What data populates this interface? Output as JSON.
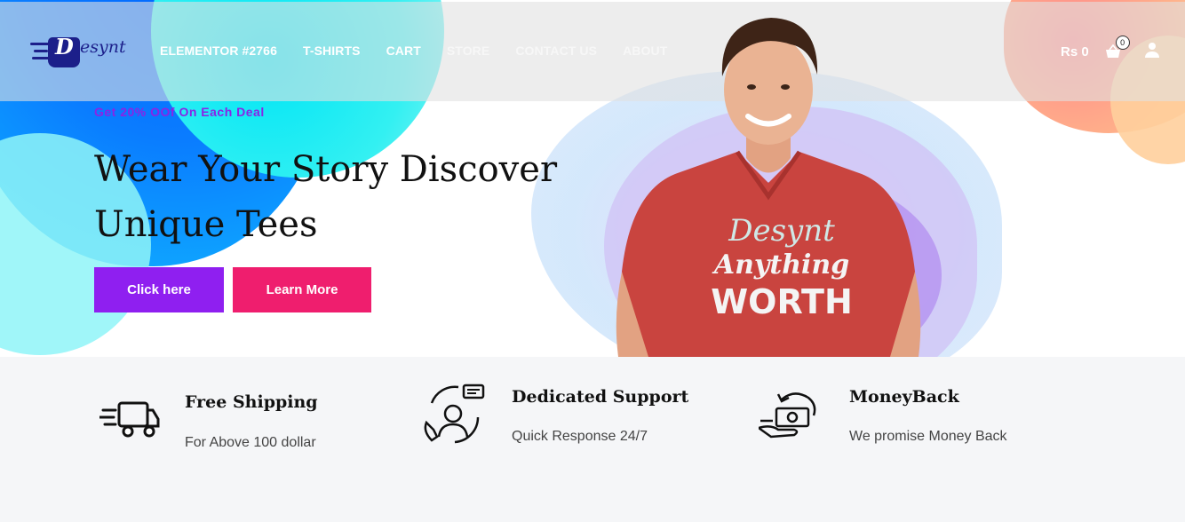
{
  "logo": {
    "text": "Desynt",
    "icon": "shopping-bag-logo"
  },
  "nav": [
    {
      "label": "ELEMENTOR #2766"
    },
    {
      "label": "T-SHIRTS"
    },
    {
      "label": "CART"
    },
    {
      "label": "STORE"
    },
    {
      "label": "CONTACT US"
    },
    {
      "label": "ABOUT"
    }
  ],
  "header": {
    "cart_total": "Rs 0",
    "cart_count": "0",
    "cart_icon": "basket-icon",
    "user_icon": "user-icon"
  },
  "hero": {
    "deal_text": "Get 20% OOf On Each Deal",
    "headline": "Wear Your Story Discover Unique Tees",
    "primary_button": "Click here",
    "secondary_button": "Learn More",
    "shirt_print": {
      "line1": "Desynt",
      "line2": "Anything",
      "line3": "WORTH"
    }
  },
  "features": [
    {
      "icon": "delivery-truck-icon",
      "title": "Free Shipping",
      "desc": "For Above 100 dollar"
    },
    {
      "icon": "support-agent-icon",
      "title": "Dedicated Support",
      "desc": "Quick Response 24/7"
    },
    {
      "icon": "money-back-icon",
      "title": "MoneyBack",
      "desc": "We promise Money Back"
    }
  ],
  "colors": {
    "primary": "#8f1ff0",
    "secondary": "#ef1e6e",
    "deal": "#8a24e6",
    "brand": "#1c1f8a"
  }
}
